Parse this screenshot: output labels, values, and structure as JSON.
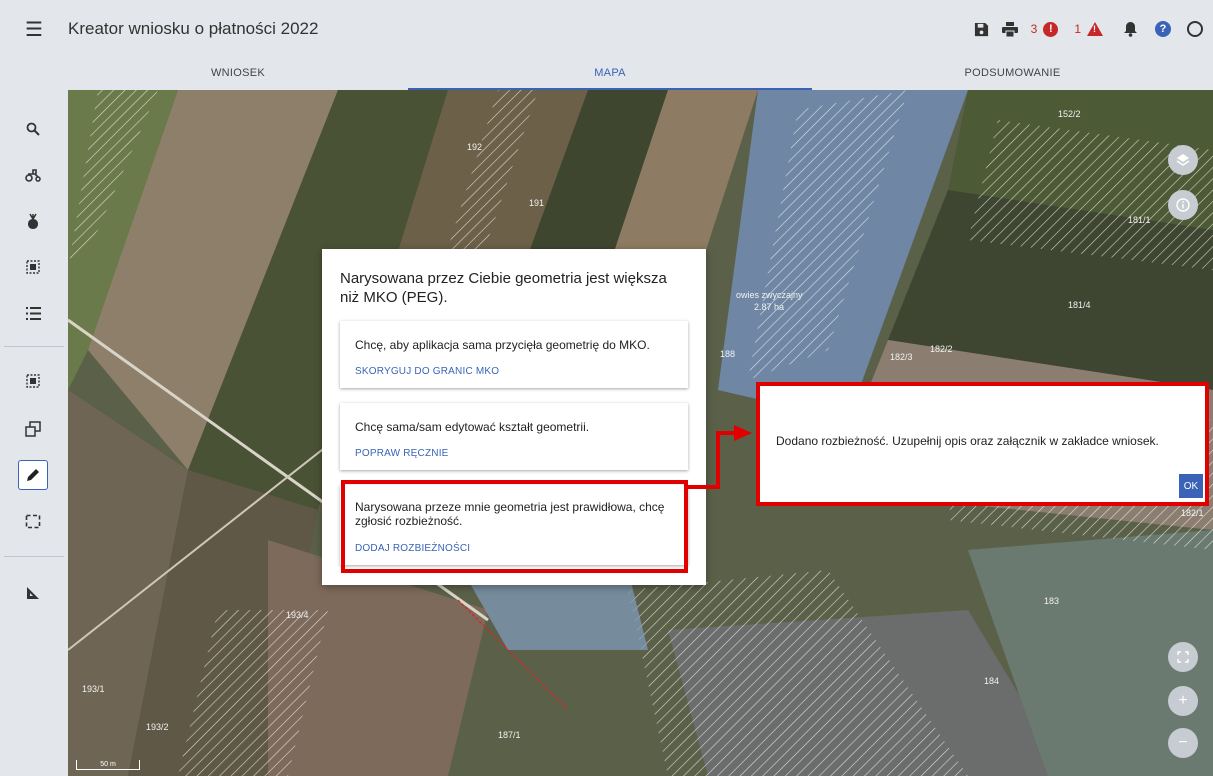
{
  "app": {
    "title": "Kreator wniosku o płatności 2022",
    "error_count": "3",
    "warning_count": "1"
  },
  "tabs": [
    {
      "label": "WNIOSEK",
      "active": false
    },
    {
      "label": "MAPA",
      "active": true
    },
    {
      "label": "PODSUMOWANIE",
      "active": false
    }
  ],
  "sidebar_icons": [
    "search-icon",
    "tractor-icon",
    "plant-icon",
    "select-area-icon",
    "list-icon",
    "select-area-icon",
    "copy-icon",
    "pencil-icon",
    "dashed-rectangle-icon",
    "measure-icon"
  ],
  "map": {
    "parcels": [
      "192",
      "191",
      "188",
      "152/2",
      "181/1",
      "181/4",
      "182/2",
      "182/3",
      "182/1",
      "183",
      "184",
      "193/4",
      "193/1",
      "193/2",
      "187/1"
    ],
    "crop_label": "owies zwyczajny",
    "crop_area": "2.87 ha",
    "scale": "50 m"
  },
  "dialog": {
    "title": "Narysowana przez Ciebie geometria jest większa niż MKO (PEG).",
    "options": [
      {
        "text": "Chcę, aby aplikacja sama przycięła geometrię do MKO.",
        "action": "SKORYGUJ DO GRANIC MKO"
      },
      {
        "text": "Chcę sama/sam edytować kształt geometrii.",
        "action": "POPRAW RĘCZNIE"
      },
      {
        "text": "Narysowana przeze mnie geometria jest prawidłowa, chcę zgłosić rozbieżność.",
        "action": "DODAJ ROZBIEŻNOŚCI"
      }
    ]
  },
  "notification": {
    "text": "Dodano rozbieżność. Uzupełnij opis oraz załącznik w zakładce wniosek.",
    "ok": "OK"
  },
  "colors": {
    "accent": "#3a63b8",
    "highlight": "#e00000",
    "error": "#c62828"
  }
}
